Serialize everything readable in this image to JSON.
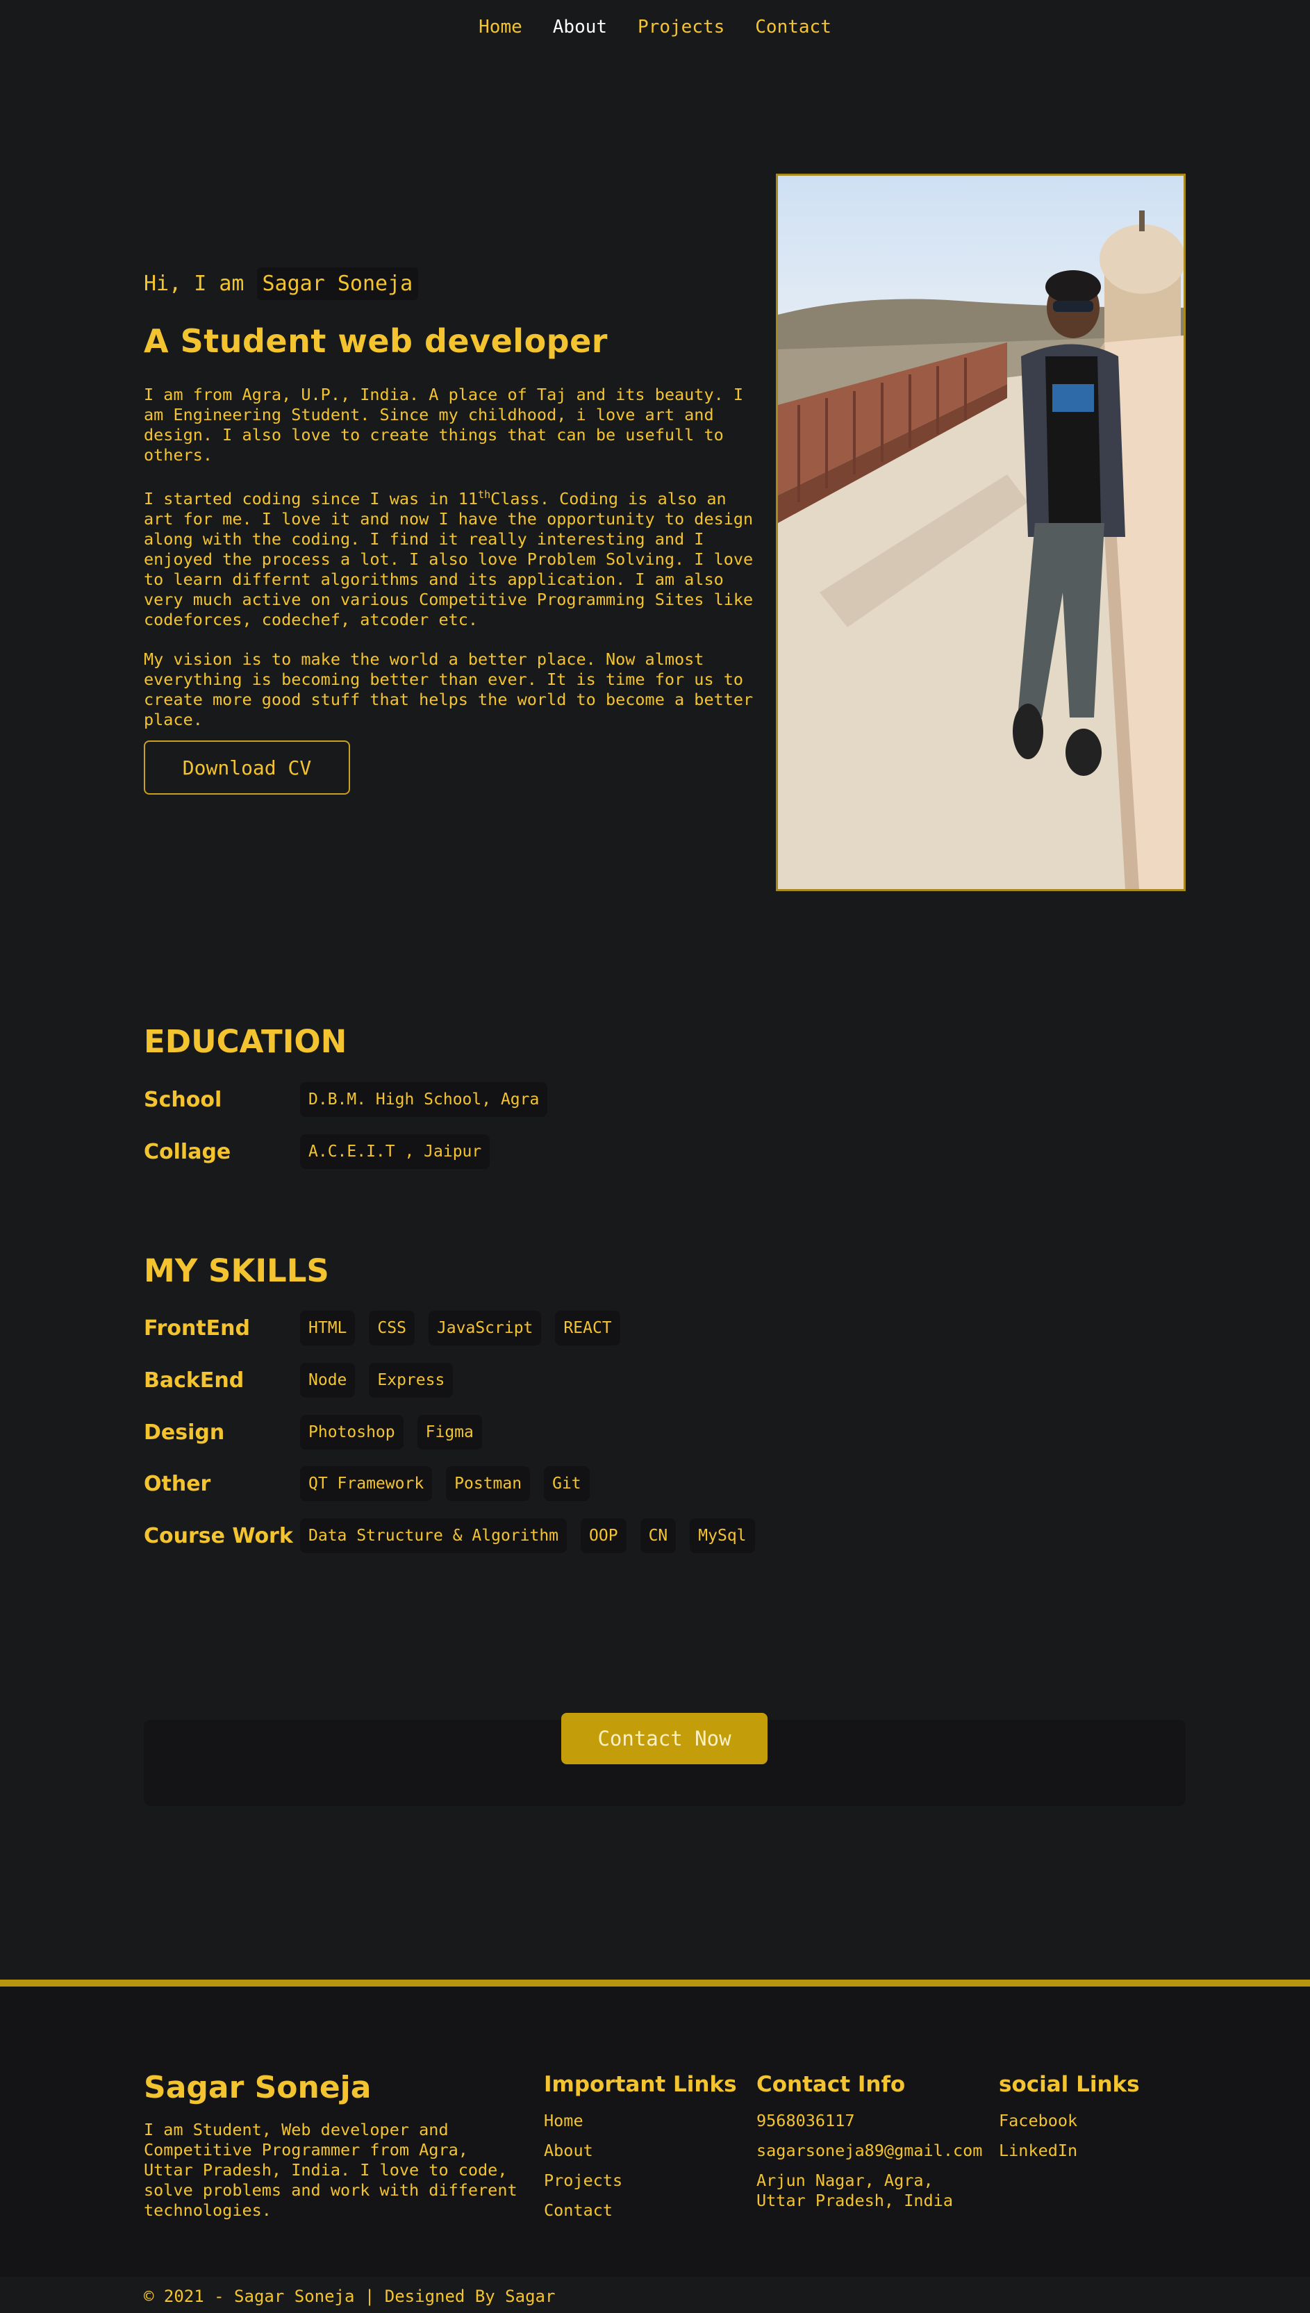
{
  "nav": {
    "items": [
      "Home",
      "About",
      "Projects",
      "Contact"
    ],
    "active": "About"
  },
  "hero": {
    "greeting": "Hi, I am",
    "name": "Sagar Soneja",
    "role": "A Student web developer",
    "para1": "I am from Agra, U.P., India. A place of Taj and its beauty. I am Engineering Student. Since my childhood, i love art and design. I also love to create things that can be usefull to others.",
    "para2_pre": "I started coding since I was in 11",
    "para2_sup": "th",
    "para2_post": "Class. Coding is also an art for me. I love it and now I have the opportunity to design along with the coding. I find it really interesting and I enjoyed the process a lot. I also love Problem Solving. I love to learn differnt algorithms and its application. I am also very much active on various Competitive Programming Sites like codeforces, codechef, atcoder etc.",
    "para3": "My vision is to make the world a better place. Now almost everything is becoming better than ever. It is time for us to create more good stuff that helps the world to become a better place.",
    "cv_button": "Download CV"
  },
  "education": {
    "title": "EDUCATION",
    "rows": [
      {
        "label": "School",
        "items": [
          "D.B.M. High School, Agra"
        ]
      },
      {
        "label": "Collage",
        "items": [
          "A.C.E.I.T , Jaipur"
        ]
      }
    ]
  },
  "skills": {
    "title": "MY SKILLS",
    "rows": [
      {
        "label": "FrontEnd",
        "items": [
          "HTML",
          "CSS",
          "JavaScript",
          "REACT"
        ]
      },
      {
        "label": "BackEnd",
        "items": [
          "Node",
          "Express"
        ]
      },
      {
        "label": "Design",
        "items": [
          "Photoshop",
          "Figma"
        ]
      },
      {
        "label": "Other",
        "items": [
          "QT Framework",
          "Postman",
          "Git"
        ]
      },
      {
        "label": "Course Work",
        "items": [
          "Data Structure & Algorithm",
          "OOP",
          "CN",
          "MySql"
        ]
      }
    ]
  },
  "contact": {
    "button": "Contact Now"
  },
  "footer": {
    "name": "Sagar Soneja",
    "about": "I am Student, Web developer and Competitive Programmer from Agra, Uttar Pradesh, India. I love to code, solve problems and work with different technologies.",
    "links_title": "Important Links",
    "links": [
      "Home",
      "About",
      "Projects",
      "Contact"
    ],
    "contact_title": "Contact Info",
    "phone": "9568036117",
    "email": "sagarsoneja89@gmail.com",
    "address": "Arjun Nagar, Agra, Uttar Pradesh, India",
    "social_title": "social Links",
    "social": [
      "Facebook",
      "LinkedIn"
    ],
    "copyright": "© 2021 - Sagar Soneja | Designed By Sagar"
  },
  "colors": {
    "accent": "#f4c430",
    "background": "#18191b",
    "button": "#c49e0a"
  }
}
